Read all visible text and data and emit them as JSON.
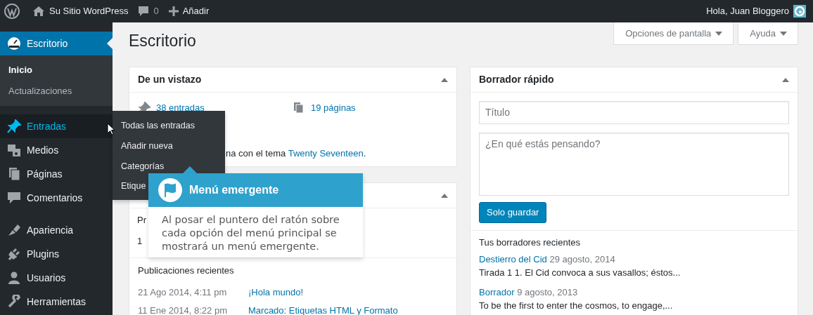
{
  "admin_bar": {
    "site_name": "Su Sitio WordPress",
    "comments_count": "0",
    "new_label": "Añadir",
    "greeting": "Hola, Juan Bloggero"
  },
  "sidebar": {
    "sections": [
      [
        {
          "label": "Escritorio",
          "selected": true,
          "hovered": false,
          "children": [
            {
              "label": "Inicio",
              "selected": true
            },
            {
              "label": "Actualizaciones",
              "selected": false
            }
          ]
        }
      ],
      [
        {
          "label": "Entradas",
          "selected": false,
          "hovered": true
        },
        {
          "label": "Medios",
          "selected": false,
          "hovered": false
        },
        {
          "label": "Páginas",
          "selected": false,
          "hovered": false
        },
        {
          "label": "Comentarios",
          "selected": false,
          "hovered": false
        }
      ],
      [
        {
          "label": "Apariencia",
          "selected": false,
          "hovered": false
        },
        {
          "label": "Plugins",
          "selected": false,
          "hovered": false
        },
        {
          "label": "Usuarios",
          "selected": false,
          "hovered": false
        },
        {
          "label": "Herramientas",
          "selected": false,
          "hovered": false
        }
      ]
    ]
  },
  "flyout": {
    "items": [
      "Todas las entradas",
      "Añadir nueva",
      "Categorías",
      "Etique"
    ]
  },
  "screen_meta": [
    "Opciones de pantalla",
    "Ayuda"
  ],
  "page_title": "Escritorio",
  "glance": {
    "title": "De un vistazo",
    "stats": [
      "38 entradas",
      "19 páginas"
    ],
    "theme_text": "na con el tema ",
    "theme_link": "Twenty Seventeen",
    "theme_after": "."
  },
  "activity": {
    "fragments": [
      "Pr",
      "1"
    ],
    "section_title": "Publicaciones recientes",
    "posts": [
      {
        "date": "21 Ago 2014, 4:11 pm",
        "title": "¡Hola mundo!"
      },
      {
        "date": "11 Ene 2014, 8:22 pm",
        "title": "Marcado: Etiquetas HTML y Formato"
      }
    ]
  },
  "quick_draft": {
    "title": "Borrador rápido",
    "title_placeholder": "Título",
    "content_placeholder": "¿En qué estás pensando?",
    "button": "Solo guardar",
    "drafts_heading": "Tus borradores recientes",
    "drafts": [
      {
        "title": "Destierro del Cid",
        "date": "29 agosto, 2014",
        "excerpt": "Tirada 1 1. El Cid convoca a sus vasallos; éstos..."
      },
      {
        "title": "Borrador",
        "date": "9 agosto, 2013",
        "excerpt": "To be the first to enter the cosmos, to engage,..."
      }
    ]
  },
  "tooltip": {
    "title": "Menú emergente",
    "body": "Al posar el puntero del ratón sobre cada opción del menú principal se mostrará un menú emergente."
  }
}
